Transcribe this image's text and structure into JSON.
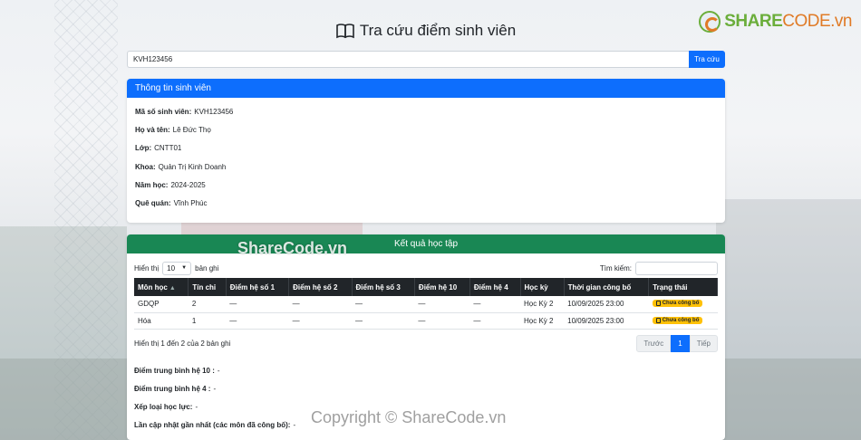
{
  "page": {
    "title": "Tra cứu điểm sinh viên",
    "brand": {
      "part1": "SHARE",
      "part2": "CODE.vn"
    }
  },
  "search": {
    "value": "KVH123456",
    "button_label": "Tra cứu"
  },
  "student_card": {
    "header": "Thông tin sinh viên",
    "fields": [
      {
        "label": "Mã số sinh viên:",
        "value": "KVH123456"
      },
      {
        "label": "Họ và tên:",
        "value": "Lê Đức Thọ"
      },
      {
        "label": "Lớp:",
        "value": "CNTT01"
      },
      {
        "label": "Khoa:",
        "value": "Quản Trị Kinh Doanh"
      },
      {
        "label": "Năm học:",
        "value": "2024-2025"
      },
      {
        "label": "Quê quán:",
        "value": "Vĩnh Phúc"
      }
    ]
  },
  "results_card": {
    "header": "Kết quả học tập",
    "show_prefix": "Hiển thị",
    "page_size": "10",
    "show_suffix": "bản ghi",
    "search_label": "Tìm kiếm:",
    "columns": [
      "Môn học",
      "Tín chỉ",
      "Điểm hệ số 1",
      "Điểm hệ số 2",
      "Điểm hệ số 3",
      "Điểm hệ 10",
      "Điểm hệ 4",
      "Học kỳ",
      "Thời gian công bố",
      "Trạng thái"
    ],
    "rows": [
      [
        "GDQP",
        "2",
        "—",
        "—",
        "—",
        "—",
        "—",
        "Học Kỳ 2",
        "10/09/2025 23:00",
        "Chưa công bố"
      ],
      [
        "Hóa",
        "1",
        "—",
        "—",
        "—",
        "—",
        "—",
        "Học Kỳ 2",
        "10/09/2025 23:00",
        "Chưa công bố"
      ]
    ],
    "info_text": "Hiển thị 1 đến 2 của 2 bản ghi",
    "pager": {
      "prev": "Trước",
      "current": "1",
      "next": "Tiếp"
    },
    "stats": [
      {
        "label": "Điểm trung bình hệ 10 :",
        "value": "-"
      },
      {
        "label": "Điểm trung bình hệ 4 :",
        "value": "-"
      },
      {
        "label": "Xếp loại học lực:",
        "value": "-"
      },
      {
        "label": "Lần cập nhật gần nhất (các môn đã công bố):",
        "value": "-"
      }
    ]
  },
  "watermarks": {
    "top": "ShareCode.vn",
    "bottom": "Copyright © ShareCode.vn"
  },
  "colors": {
    "primary": "#0d6efd",
    "success": "#198754",
    "warning": "#ffc107",
    "dark": "#212529"
  }
}
